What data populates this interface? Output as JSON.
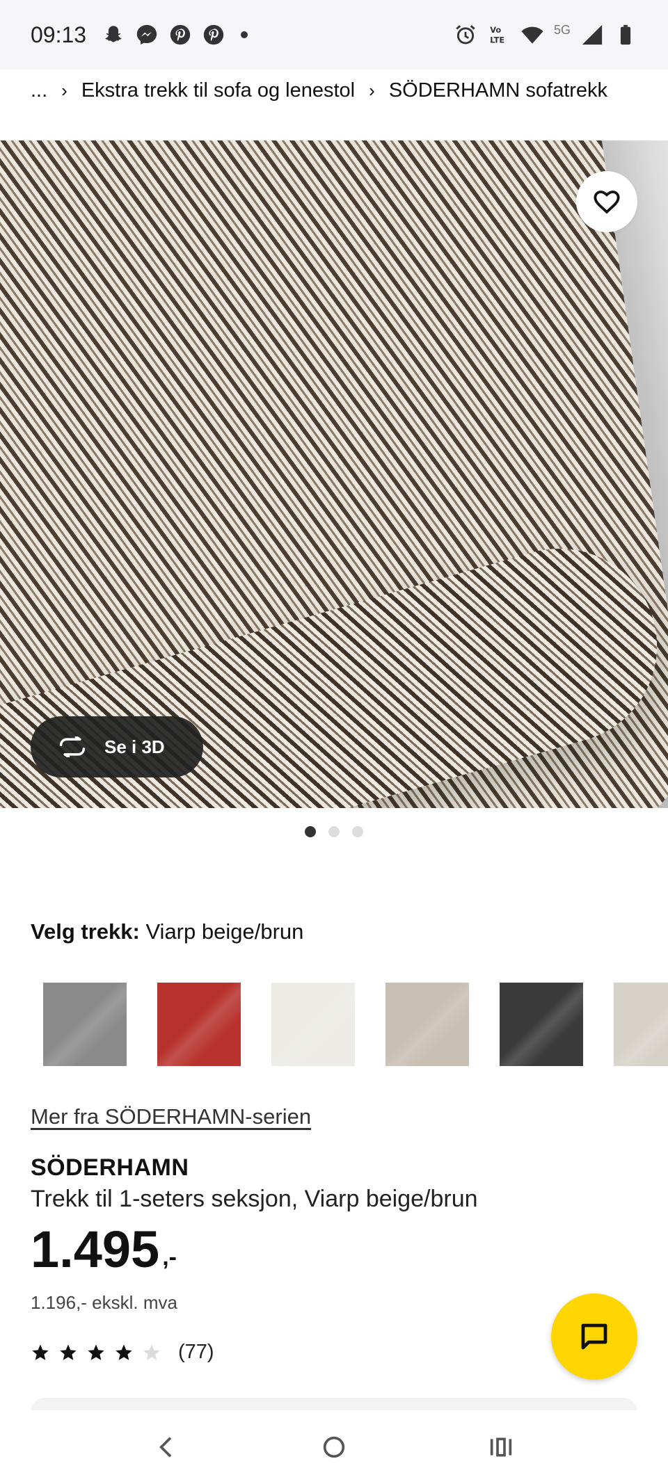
{
  "status_bar": {
    "time": "09:13",
    "left_icons": [
      "snapchat-icon",
      "messenger-icon",
      "pinterest-icon",
      "pinterest-icon",
      "dot-icon"
    ],
    "right_icons": [
      "alarm-icon",
      "volte-icon",
      "wifi-icon",
      "signal-icon",
      "battery-icon"
    ],
    "network": "5G"
  },
  "breadcrumb": {
    "ellipsis": "...",
    "items": [
      "Ekstra trekk til sofa og lenestol",
      "SÖDERHAMN sofatrekk"
    ]
  },
  "gallery": {
    "see_3d_label": "Se i 3D",
    "dots_total": 3,
    "active_dot": 1
  },
  "variant": {
    "label": "Velg trekk:",
    "selected": "Viarp beige/brun",
    "swatch_colors": [
      "#8a8a8a",
      "#b8332e",
      "#ecebe5",
      "#c8bfb3",
      "#3a3a3a",
      "#d7d2c8"
    ]
  },
  "product": {
    "series_link": "Mer fra SÖDERHAMN-serien",
    "brand": "SÖDERHAMN",
    "description": "Trekk til 1-seters seksjon, Viarp beige/brun",
    "price_int": "1.495",
    "price_suffix": ",-",
    "price_ex_vat": "1.196,- ekskl. mva",
    "rating": 4,
    "rating_max": 5,
    "review_count": "(77)"
  },
  "colors": {
    "fab": "#ffd500",
    "status_bg": "#f6f5fa"
  }
}
